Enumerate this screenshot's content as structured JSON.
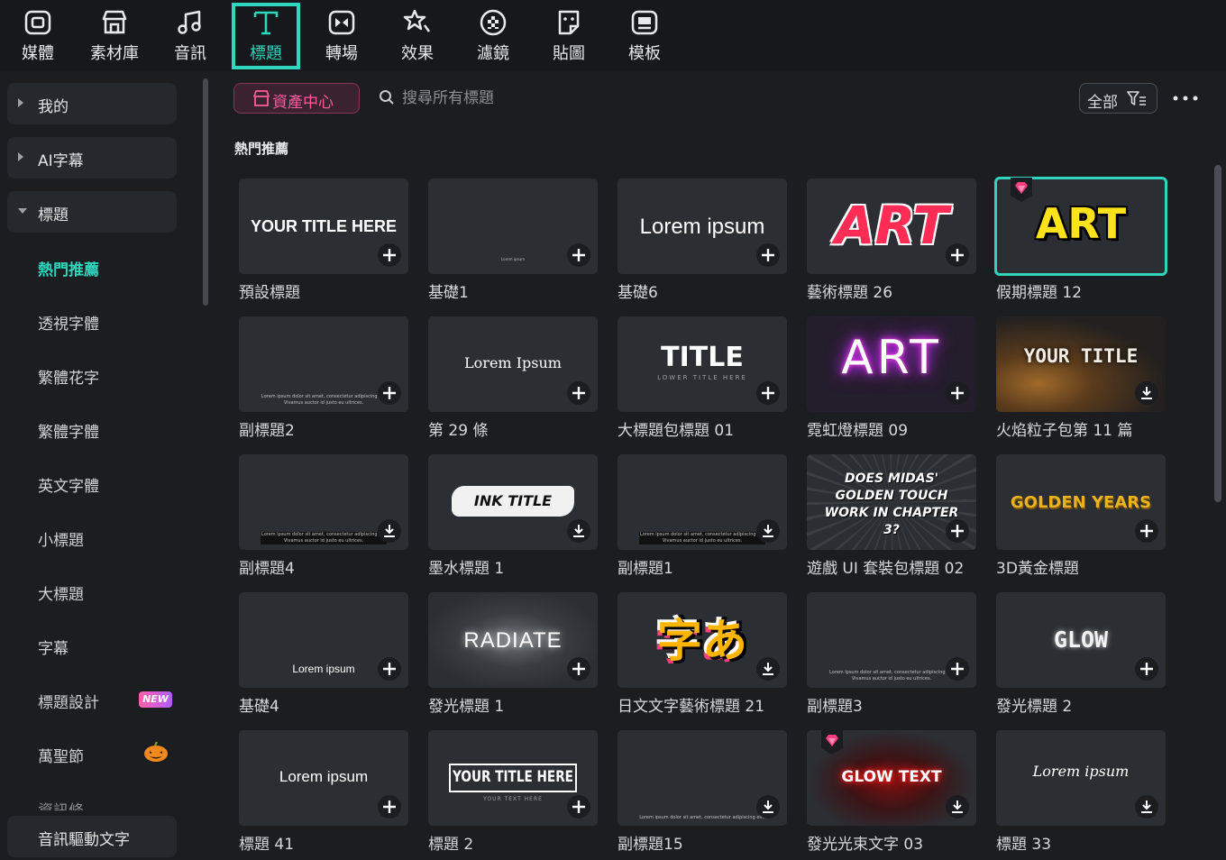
{
  "toolbar": {
    "items": [
      {
        "label": "媒體",
        "icon": "media-icon"
      },
      {
        "label": "素材庫",
        "icon": "library-icon"
      },
      {
        "label": "音訊",
        "icon": "music-icon"
      },
      {
        "label": "標題",
        "icon": "title-icon",
        "active": true
      },
      {
        "label": "轉場",
        "icon": "transition-icon"
      },
      {
        "label": "效果",
        "icon": "effects-icon"
      },
      {
        "label": "濾鏡",
        "icon": "filter-icon"
      },
      {
        "label": "貼圖",
        "icon": "sticker-icon"
      },
      {
        "label": "模板",
        "icon": "template-icon"
      }
    ]
  },
  "sidebar": {
    "categories": [
      {
        "label": "我的",
        "expanded": false
      },
      {
        "label": "AI字幕",
        "expanded": false
      },
      {
        "label": "標題",
        "expanded": true
      }
    ],
    "subitems": [
      {
        "label": "熱門推薦",
        "active": true
      },
      {
        "label": "透視字體"
      },
      {
        "label": "繁體花字"
      },
      {
        "label": "繁體字體"
      },
      {
        "label": "英文字體"
      },
      {
        "label": "小標題"
      },
      {
        "label": "大標題"
      },
      {
        "label": "字幕"
      },
      {
        "label": "標題設計",
        "badge": "NEW"
      },
      {
        "label": "萬聖節",
        "icon": "pumpkin-icon"
      },
      {
        "label": "資訊條"
      }
    ],
    "bottom_category": "音訊驅動文字"
  },
  "header": {
    "asset_center": "資產中心",
    "search_placeholder": "搜尋所有標題",
    "filter_label": "全部",
    "section_title": "熱門推薦"
  },
  "colors": {
    "accent": "#2fd6bd",
    "asset_pink": "#ff5c9c",
    "background": "#1b1d21",
    "card": "#2b2e33"
  },
  "cards": [
    {
      "label": "預設標題",
      "thumb": "YOUR TITLE HERE",
      "action": "add"
    },
    {
      "label": "基礎1",
      "thumb": "Lorem ipsum",
      "action": "add"
    },
    {
      "label": "基礎6",
      "thumb": "Lorem ipsum",
      "action": "add"
    },
    {
      "label": "藝術標題 26",
      "thumb": "ART",
      "action": "add"
    },
    {
      "label": "假期標題 12",
      "thumb": "ART",
      "action": "none",
      "premium": true,
      "selected": true
    },
    {
      "label": "副標題2",
      "thumb": "Lorem ipsum dolor sit amet, consectetur adipiscing elit Vivamus auctor id justo eu ultrices.",
      "action": "add"
    },
    {
      "label": "第 29 條",
      "thumb": "Lorem Ipsum",
      "action": "add"
    },
    {
      "label": "大標題包標題 01",
      "thumb": "TITLE",
      "thumb_sub": "LOWER TITLE HERE",
      "action": "add"
    },
    {
      "label": "霓虹燈標題 09",
      "thumb": "ART",
      "action": "add"
    },
    {
      "label": "火焰粒子包第 11 篇",
      "thumb": "YOUR TITLE",
      "action": "download"
    },
    {
      "label": "副標題4",
      "thumb": "Lorem ipsum dolor sit amet, consectetur adipiscing elit Vivamus auctor id justo eu ultrices.",
      "action": "download"
    },
    {
      "label": "墨水標題 1",
      "thumb": "INK TITLE",
      "action": "download"
    },
    {
      "label": "副標題1",
      "thumb": "Lorem ipsum dolor sit amet, consectetur adipiscing elit Vivamus auctor id justo eu ultrices.",
      "action": "download"
    },
    {
      "label": "遊戲 UI 套裝包標題 02",
      "thumb": "DOES MIDAS' GOLDEN TOUCH WORK IN CHAPTER 3?",
      "action": "add"
    },
    {
      "label": "3D黃金標題",
      "thumb": "GOLDEN YEARS",
      "action": "add"
    },
    {
      "label": "基礎4",
      "thumb": "Lorem ipsum",
      "action": "add"
    },
    {
      "label": "發光標題 1",
      "thumb": "RADIATE",
      "action": "add"
    },
    {
      "label": "日文文字藝術標題 21",
      "thumb": "字あ",
      "action": "download"
    },
    {
      "label": "副標題3",
      "thumb": "Lorem ipsum dolor sit amet, consectetur adipiscing elit Vivamus auctor id justo eu ultrices.",
      "action": "add"
    },
    {
      "label": "發光標題 2",
      "thumb": "GLOW",
      "action": "add"
    },
    {
      "label": "標題 41",
      "thumb": "Lorem ipsum",
      "action": "add"
    },
    {
      "label": "標題 2",
      "thumb": "YOUR TITLE HERE",
      "thumb_sub": "YOUR TEXT HERE",
      "action": "add"
    },
    {
      "label": "副標題15",
      "thumb": "Lorem ipsum dolor sit amet, consectetur adipiscing elit.",
      "action": "download"
    },
    {
      "label": "發光光束文字 03",
      "thumb": "GLOW TEXT",
      "action": "download",
      "premium": true
    },
    {
      "label": "標題 33",
      "thumb": "Lorem ipsum",
      "action": "download"
    }
  ]
}
